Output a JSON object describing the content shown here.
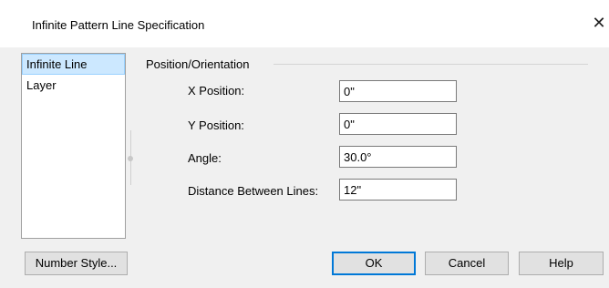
{
  "window": {
    "title": "Infinite Pattern Line Specification",
    "close_glyph": "✕"
  },
  "nav": {
    "items": [
      {
        "label": "Infinite Line",
        "selected": true
      },
      {
        "label": "Layer",
        "selected": false
      }
    ]
  },
  "group": {
    "title": "Position/Orientation"
  },
  "fields": {
    "x_position": {
      "label": "X Position:",
      "value": "0\""
    },
    "y_position": {
      "label": "Y Position:",
      "value": "0\""
    },
    "angle": {
      "label": "Angle:",
      "value": "30.0°"
    },
    "distance": {
      "label": "Distance Between Lines:",
      "value": "12\""
    }
  },
  "buttons": {
    "number_style": "Number Style...",
    "ok": "OK",
    "cancel": "Cancel",
    "help": "Help"
  },
  "colors": {
    "selection_bg": "#cce8ff",
    "default_button_border": "#0078d7"
  }
}
